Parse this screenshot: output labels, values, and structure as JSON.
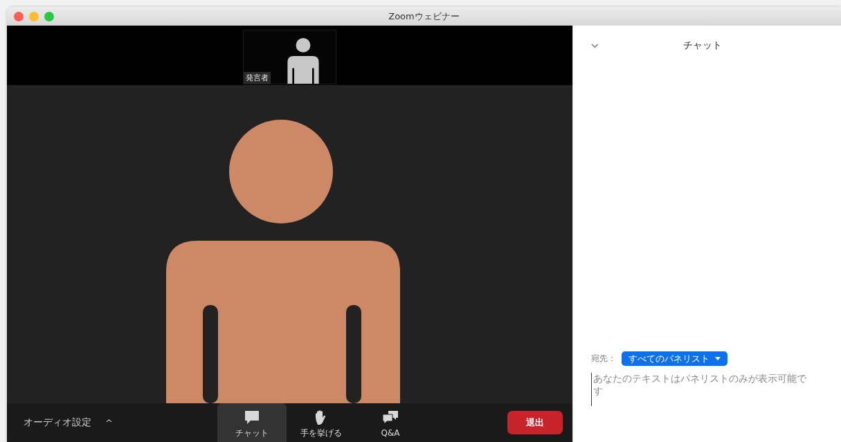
{
  "window": {
    "title": "Zoomウェビナー"
  },
  "speaker_thumbnail": {
    "label": "発言者"
  },
  "toolbar": {
    "audio": {
      "label": "オーディオ設定",
      "caret": "^"
    },
    "items": [
      {
        "kind": "chat",
        "label": "チャット",
        "selected": true
      },
      {
        "kind": "hand",
        "label": "手を挙げる",
        "selected": false
      },
      {
        "kind": "qa",
        "label": "Q&A",
        "selected": false
      }
    ],
    "leave_button": "退出"
  },
  "chat": {
    "title": "チャット",
    "recipient_label": "宛先：",
    "recipient": "すべてのパネリスト",
    "placeholder": "あなたのテキストはパネリストのみが表示可能です"
  }
}
